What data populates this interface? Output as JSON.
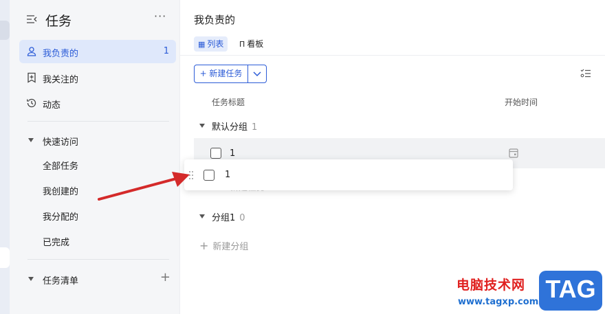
{
  "sidebar": {
    "title": "任务",
    "more": "···",
    "nav": [
      {
        "label": "我负责的",
        "count": "1"
      },
      {
        "label": "我关注的"
      },
      {
        "label": "动态"
      }
    ],
    "quick_access": {
      "label": "快速访问",
      "items": [
        "全部任务",
        "我创建的",
        "我分配的",
        "已完成"
      ]
    },
    "task_list": {
      "label": "任务清单",
      "add": "+"
    }
  },
  "main": {
    "title": "我负责的",
    "tabs": [
      {
        "label": "列表",
        "icon": "list-icon"
      },
      {
        "label": "看板",
        "icon": "board-icon"
      }
    ],
    "new_task_button": "+ 新建任务",
    "columns": {
      "title": "任务标题",
      "start": "开始时间"
    },
    "groups": [
      {
        "label": "默认分组",
        "count": "1"
      },
      {
        "label": "分组1",
        "count": "0"
      }
    ],
    "task": {
      "title": "1"
    },
    "ghost_new_task": "新建任务",
    "add_group": "新建分组",
    "add_group_plus": "+"
  },
  "drag_card": {
    "title": "1"
  },
  "watermark": {
    "site_name": "电脑技术网",
    "url": "www.tagxp.com",
    "badge": "TAG"
  },
  "colors": {
    "accent": "#2b5bd7",
    "active_bg": "#dfe8fb",
    "arrow": "#d42a2a"
  }
}
